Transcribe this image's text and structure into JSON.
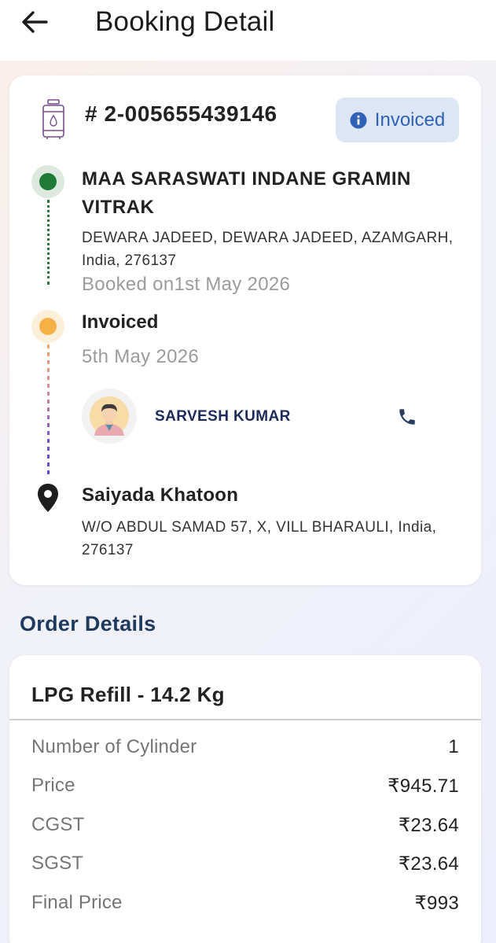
{
  "header": {
    "title": "Booking Detail",
    "back_icon": "arrow-left-icon"
  },
  "booking": {
    "number": "# 2-005655439146",
    "status": "Invoiced",
    "status_color": "#2f62b6"
  },
  "distributor": {
    "name": "MAA SARASWATI INDANE GRAMIN VITRAK",
    "address": "DEWARA JADEED, DEWARA JADEED, AZAMGARH, India, 276137",
    "booked_on": "Booked on1st May 2026"
  },
  "invoice": {
    "label": "Invoiced",
    "date": "5th May 2026"
  },
  "agent": {
    "name": "SARVESH KUMAR",
    "call_icon": "phone-icon"
  },
  "customer": {
    "name": "Saiyada Khatoon",
    "address": "W/O ABDUL SAMAD 57, X, VILL BHARAULI, India, 276137"
  },
  "order": {
    "section_title": "Order Details",
    "product": "LPG Refill - 14.2 Kg",
    "rows": [
      {
        "label": "Number of Cylinder",
        "value": "1"
      },
      {
        "label": "Price",
        "value": "₹945.71"
      },
      {
        "label": "CGST",
        "value": "₹23.64"
      },
      {
        "label": "SGST",
        "value": "₹23.64"
      },
      {
        "label": "Final Price",
        "value": "₹993"
      }
    ]
  }
}
